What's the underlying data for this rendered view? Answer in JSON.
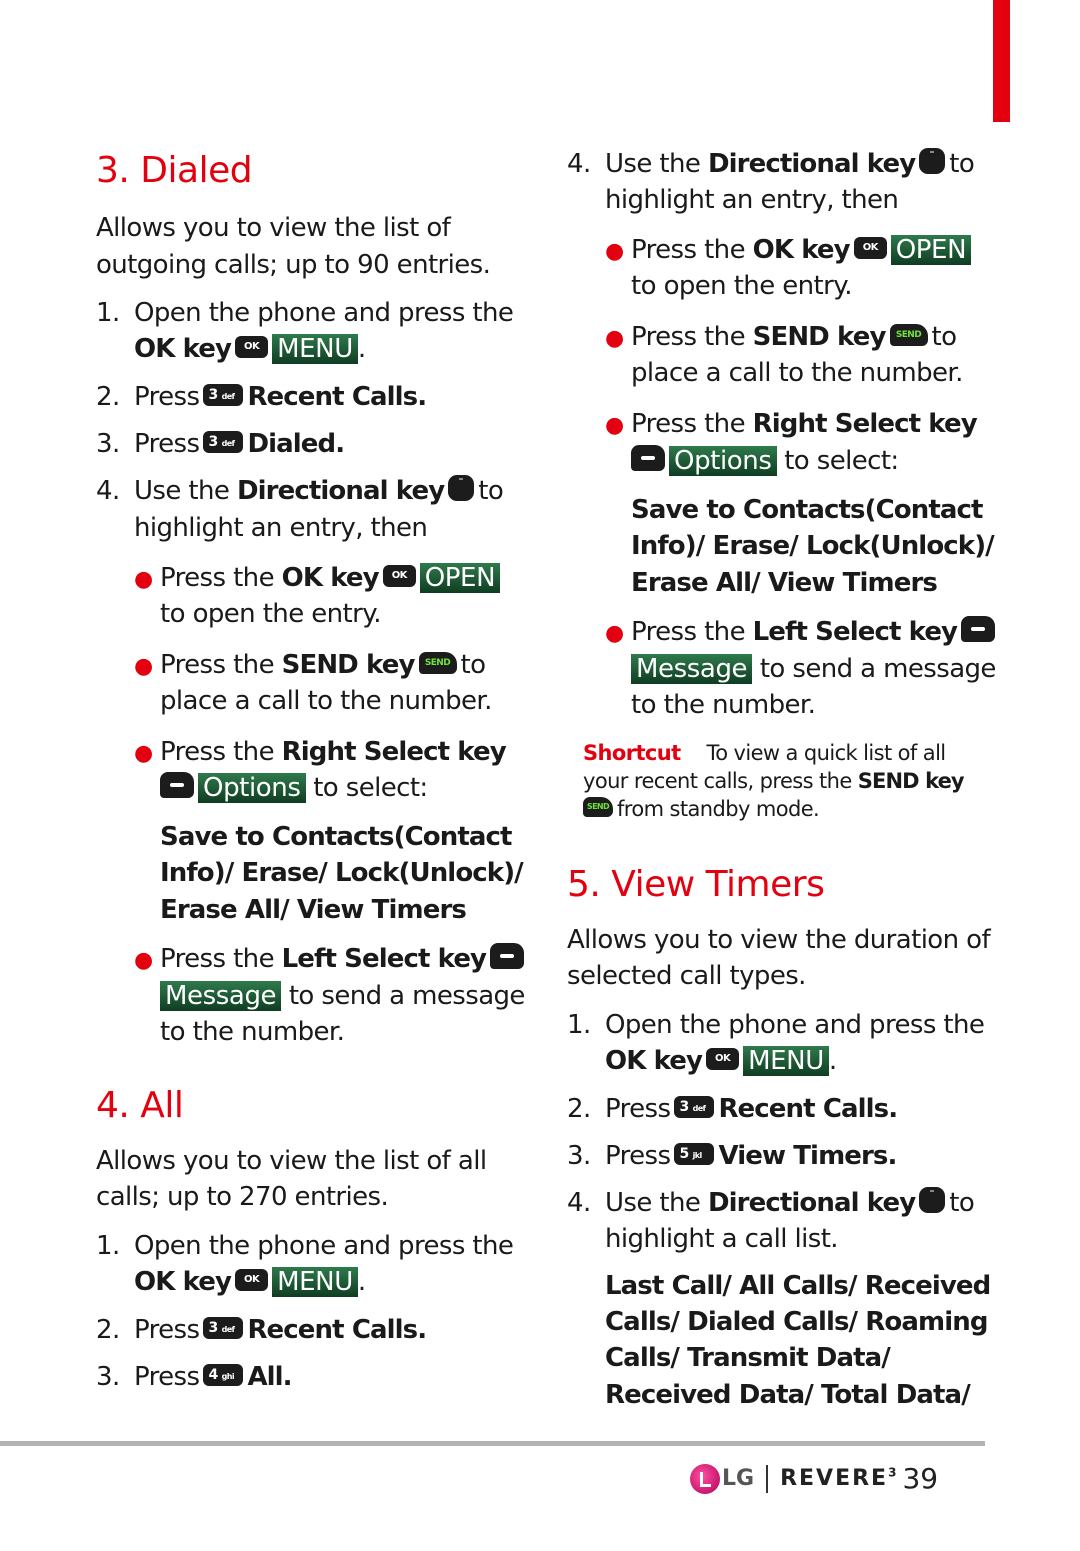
{
  "accent_color": "#e3000f",
  "softkey_color": "#1f5a35",
  "left": {
    "dialed": {
      "heading": "3. Dialed",
      "intro_1": "Allows you to view the list of",
      "intro_2": "outgoing calls; up to 90 entries.",
      "step1_num": "1.",
      "step1_a": "Open the phone and press the",
      "step1_b": "OK key",
      "step1_key": "OK",
      "step1_label": "MENU",
      "step1_end": ".",
      "step2_num": "2.",
      "step2_a": "Press",
      "step2_key": "3",
      "step2_key_sub": "def",
      "step2_b": "Recent Calls.",
      "step3_num": "3.",
      "step3_a": "Press",
      "step3_key": "3",
      "step3_key_sub": "def",
      "step3_b": "Dialed.",
      "step4_num": "4.",
      "step4_a": "Use the",
      "step4_b": "Directional key",
      "step4_c": "to",
      "step4_d": "highlight an entry, then",
      "b1_a": "Press the",
      "b1_b": "OK key",
      "b1_key": "OK",
      "b1_label": "OPEN",
      "b1_c": "to open the entry.",
      "b2_a": "Press the",
      "b2_b": "SEND key",
      "b2_key": "SEND",
      "b2_c": "to",
      "b2_d": "place a call to the number.",
      "b3_a": "Press the",
      "b3_b": "Right Select key",
      "b3_label": "Options",
      "b3_c": "to select:",
      "options_1": "Save to Contacts(Contact",
      "options_2": "Info)/ Erase/ Lock(Unlock)/",
      "options_3": "Erase All/ View Timers",
      "b4_a": "Press the",
      "b4_b": "Left Select key",
      "b4_label": "Message",
      "b4_c": "to send a message",
      "b4_d": "to the number."
    },
    "all": {
      "heading": "4. All",
      "intro_1": "Allows you to view the list of all",
      "intro_2": "calls; up to 270 entries.",
      "step1_num": "1.",
      "step1_a": "Open the phone and press the",
      "step1_b": "OK key",
      "step1_key": "OK",
      "step1_label": "MENU",
      "step1_end": ".",
      "step2_num": "2.",
      "step2_a": "Press",
      "step2_key": "3",
      "step2_key_sub": "def",
      "step2_b": "Recent Calls.",
      "step3_num": "3.",
      "step3_a": "Press",
      "step3_key": "4",
      "step3_key_sub": "ghi",
      "step3_b": "All."
    }
  },
  "right": {
    "cont": {
      "step4_num": "4.",
      "step4_a": "Use the",
      "step4_b": "Directional key",
      "step4_c": "to",
      "step4_d": "highlight an entry, then",
      "b1_a": "Press the",
      "b1_b": "OK key",
      "b1_key": "OK",
      "b1_label": "OPEN",
      "b1_c": "to open the entry.",
      "b2_a": "Press the",
      "b2_b": "SEND key",
      "b2_key": "SEND",
      "b2_c": "to",
      "b2_d": "place a call to the number.",
      "b3_a": "Press the",
      "b3_b": "Right Select key",
      "b3_label": "Options",
      "b3_c": "to select:",
      "options_1": "Save to Contacts(Contact",
      "options_2": "Info)/ Erase/ Lock(Unlock)/",
      "options_3": "Erase All/ View Timers",
      "b4_a": "Press the",
      "b4_b": "Left Select key",
      "b4_label": "Message",
      "b4_c": "to send a message",
      "b4_d": "to the number."
    },
    "shortcut": {
      "label": "Shortcut",
      "line1": "To view a quick list of all",
      "line2_a": "your recent calls, press the",
      "line2_b": "SEND key",
      "key": "SEND",
      "line3": "from standby mode."
    },
    "timers": {
      "heading": "5. View Timers",
      "intro_1": "Allows you to view the duration of",
      "intro_2": "selected call types.",
      "step1_num": "1.",
      "step1_a": "Open the phone and press the",
      "step1_b": "OK key",
      "step1_key": "OK",
      "step1_label": "MENU",
      "step1_end": ".",
      "step2_num": "2.",
      "step2_a": "Press",
      "step2_key": "3",
      "step2_key_sub": "def",
      "step2_b": "Recent Calls.",
      "step3_num": "3.",
      "step3_a": "Press",
      "step3_key": "5",
      "step3_key_sub": "jkl",
      "step3_b": "View Timers.",
      "step4_num": "4.",
      "step4_a": "Use the",
      "step4_b": "Directional key",
      "step4_c": "to",
      "step4_d": "highlight a call list.",
      "list_1": "Last Call/ All Calls/ Received",
      "list_2": "Calls/ Dialed Calls/ Roaming",
      "list_3": "Calls/ Transmit Data/",
      "list_4": "Received Data/ Total Data/"
    }
  },
  "footer": {
    "brand": "LG",
    "product": "REVERE",
    "product_suffix": "3",
    "page_number": "39"
  }
}
